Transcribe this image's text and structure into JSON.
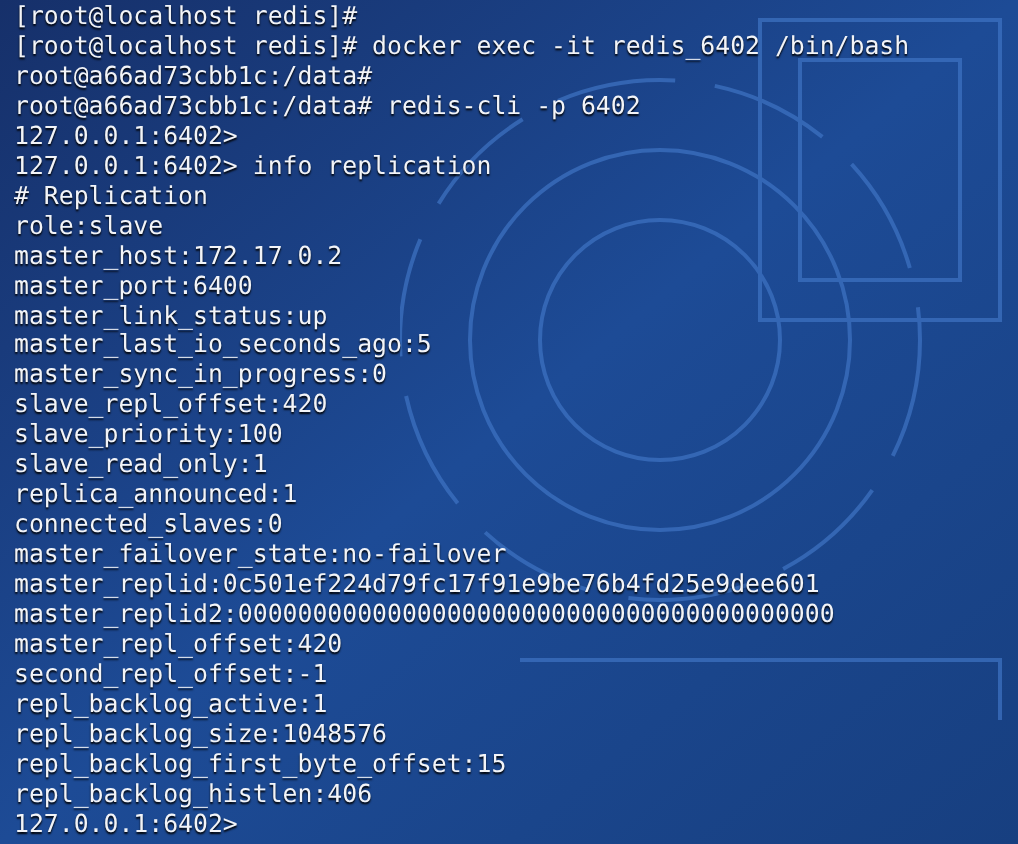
{
  "terminal": {
    "lines": [
      "[root@localhost redis]#",
      "[root@localhost redis]# docker exec -it redis_6402 /bin/bash",
      "root@a66ad73cbb1c:/data#",
      "root@a66ad73cbb1c:/data# redis-cli -p 6402",
      "127.0.0.1:6402>",
      "127.0.0.1:6402> info replication",
      "# Replication",
      "role:slave",
      "master_host:172.17.0.2",
      "master_port:6400",
      "master_link_status:up",
      "master_last_io_seconds_ago:5",
      "master_sync_in_progress:0",
      "slave_repl_offset:420",
      "slave_priority:100",
      "slave_read_only:1",
      "replica_announced:1",
      "connected_slaves:0",
      "master_failover_state:no-failover",
      "master_replid:0c501ef224d79fc17f91e9be76b4fd25e9dee601",
      "master_replid2:0000000000000000000000000000000000000000",
      "master_repl_offset:420",
      "second_repl_offset:-1",
      "repl_backlog_active:1",
      "repl_backlog_size:1048576",
      "repl_backlog_first_byte_offset:15",
      "repl_backlog_histlen:406",
      "127.0.0.1:6402>"
    ]
  }
}
